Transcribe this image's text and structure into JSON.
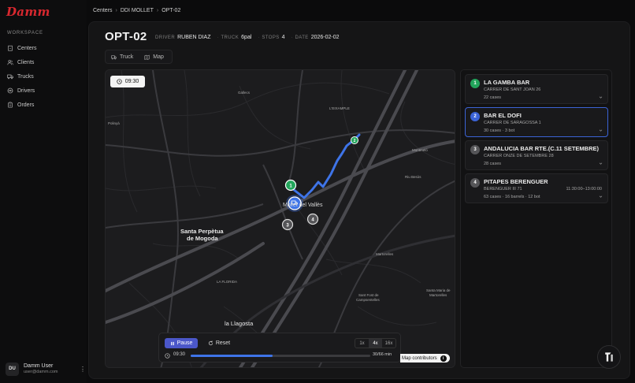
{
  "brand": {
    "logo_text": "Damm",
    "accent": "#d8282f"
  },
  "sidebar": {
    "section_label": "WORKSPACE",
    "items": [
      {
        "label": "Centers",
        "icon": "building-icon"
      },
      {
        "label": "Clients",
        "icon": "users-icon"
      },
      {
        "label": "Trucks",
        "icon": "truck-icon"
      },
      {
        "label": "Drivers",
        "icon": "steering-wheel-icon"
      },
      {
        "label": "Orders",
        "icon": "clipboard-icon"
      }
    ],
    "user": {
      "initials": "DU",
      "name": "Damm User",
      "email": "user@damm.com"
    }
  },
  "breadcrumb": [
    "Centers",
    "DDI MOLLET",
    "OPT-02"
  ],
  "route": {
    "title": "OPT-02",
    "driver_label": "DRIVER",
    "driver": "RUBEN DIAZ",
    "truck_label": "TRUCK",
    "truck": "6pal",
    "stops_label": "STOPS",
    "stops": "4",
    "date_label": "DATE",
    "date": "2026-02-02"
  },
  "tabs": [
    {
      "label": "Truck",
      "icon": "truck-icon"
    },
    {
      "label": "Map",
      "icon": "map-icon"
    }
  ],
  "map": {
    "time_chip": "09:30",
    "places": {
      "gallecs": "Gallecs",
      "polinya": "Polinyà",
      "eixample": "L'EIXAMPLE",
      "montmelo": "Montmeló",
      "riu_besos": "Riu Besòs",
      "mollet": "Mollet del Vallès",
      "santa_perpetua_1": "Santa Perpètua",
      "santa_perpetua_2": "de Mogoda",
      "la_florida": "LA FLORIDA",
      "martorelles": "Martorelles",
      "sant_fost_1": "Sant Fost de",
      "sant_fost_2": "Campsentelles",
      "santa_maria_1": "Santa Maria de",
      "santa_maria_2": "Martorelles",
      "la_llagosta": "la Llagosta"
    },
    "attribution": "Map contributors",
    "route_color": "#3e74e8"
  },
  "playback": {
    "pause_label": "Pause",
    "reset_label": "Reset",
    "speeds": [
      "1x",
      "4x",
      "16x"
    ],
    "active_speed": "4x",
    "current_time": "09:30",
    "progress_text": "30/66 min",
    "progress_fraction": 0.4545
  },
  "stops": [
    {
      "num": "1",
      "name": "LA GAMBA BAR",
      "address": "CARRER DE SANT JOAN 26",
      "detail": "22 cases",
      "window": "",
      "status_color": "#22a55b"
    },
    {
      "num": "2",
      "name": "BAR EL DOFI",
      "address": "CARRER DE SARAGOSSA 1",
      "detail": "30 cases · 3 bot",
      "window": "",
      "status_color": "#3b63d6"
    },
    {
      "num": "3",
      "name": "ANDALUCIA BAR RTE.(C.11 SETEMBRE)",
      "address": "CARRER ONZE DE SETEMBRE 28",
      "detail": "28 cases",
      "window": "",
      "status_color": "#555558"
    },
    {
      "num": "4",
      "name": "PITAPES BERENGUER",
      "address": "BERENGUER III 71",
      "detail": "63 cases · 16 barrels · 12 bot",
      "window": "11:30:00–13:00:00",
      "status_color": "#555558"
    }
  ]
}
